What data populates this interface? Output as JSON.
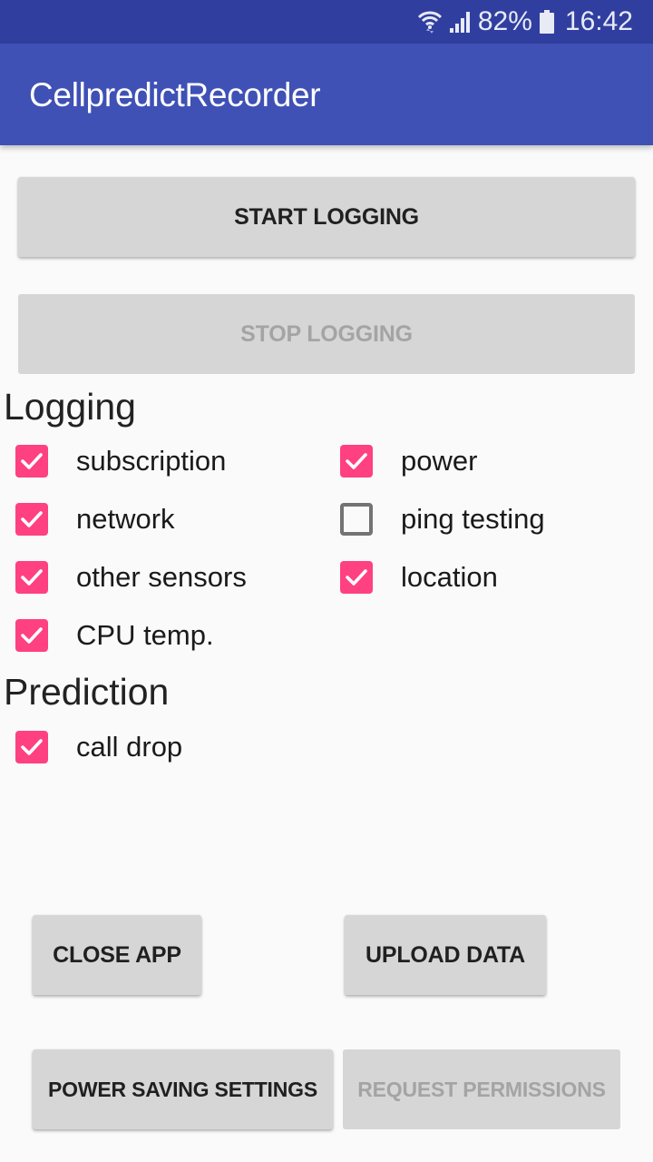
{
  "status_bar": {
    "icons": [
      "wifi-icon",
      "signal-icon",
      "battery-icon"
    ],
    "battery": "82%",
    "time": "16:42"
  },
  "app_bar": {
    "title": "CellpredictRecorder"
  },
  "controls": {
    "start_logging": {
      "label": "START LOGGING",
      "enabled": true
    },
    "stop_logging": {
      "label": "STOP LOGGING",
      "enabled": false
    }
  },
  "logging": {
    "title": "Logging",
    "options": [
      {
        "label": "subscription",
        "checked": true
      },
      {
        "label": "power",
        "checked": true
      },
      {
        "label": "network",
        "checked": true
      },
      {
        "label": "ping testing",
        "checked": false
      },
      {
        "label": "other sensors",
        "checked": true
      },
      {
        "label": "location",
        "checked": true
      },
      {
        "label": "CPU temp.",
        "checked": true
      }
    ]
  },
  "prediction": {
    "title": "Prediction",
    "options": [
      {
        "label": "call drop",
        "checked": true
      }
    ]
  },
  "actions": {
    "close_app": {
      "label": "CLOSE APP",
      "enabled": true
    },
    "upload_data": {
      "label": "UPLOAD DATA",
      "enabled": true
    },
    "power_saving": {
      "label": "POWER SAVING SETTINGS",
      "enabled": true
    },
    "request_permissions": {
      "label": "REQUEST PERMISSIONS",
      "enabled": false
    }
  },
  "colors": {
    "status_bar": "#303f9f",
    "app_bar": "#3f51b5",
    "accent": "#ff4081",
    "button": "#d6d6d6",
    "background": "#fafafa"
  }
}
